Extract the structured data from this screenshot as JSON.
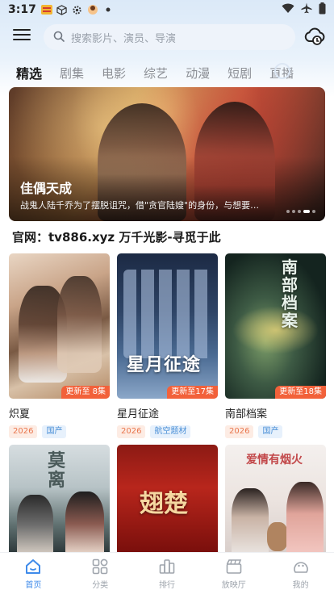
{
  "status_bar": {
    "time": "3:17"
  },
  "header": {
    "search_placeholder": "搜索影片、演员、导演"
  },
  "tabs": [
    {
      "label": "精选",
      "active": true
    },
    {
      "label": "剧集",
      "active": false
    },
    {
      "label": "电影",
      "active": false
    },
    {
      "label": "综艺",
      "active": false
    },
    {
      "label": "动漫",
      "active": false
    },
    {
      "label": "短剧",
      "active": false
    },
    {
      "label": "直播",
      "active": false
    }
  ],
  "banner": {
    "title": "佳偶天成",
    "description": "战鬼人陆千乔为了摆脱诅咒，借\"贪官陆嫂\"的身份，与想要…"
  },
  "section": {
    "title": "官网：tv886.xyz 万千光影-寻觅于此"
  },
  "cards": [
    {
      "title": "炽夏",
      "badge": "更新至 8集",
      "year": "2026",
      "category": "国产"
    },
    {
      "title": "星月征途",
      "badge": "更新至17集",
      "year": "2026",
      "category": "航空题材",
      "poster_text": "星月征途"
    },
    {
      "title": "南部档案",
      "badge": "更新至18集",
      "year": "2026",
      "category": "国产",
      "poster_text": "南部档案"
    },
    {
      "title": "",
      "poster_text": "莫离"
    },
    {
      "title": "",
      "poster_text": "翅楚"
    },
    {
      "title": "",
      "poster_text": "爱情有烟火"
    }
  ],
  "bottom_nav": [
    {
      "label": "首页",
      "icon": "home-icon",
      "active": true
    },
    {
      "label": "分类",
      "icon": "grid-icon",
      "active": false
    },
    {
      "label": "排行",
      "icon": "rank-icon",
      "active": false
    },
    {
      "label": "放映厅",
      "icon": "clapper-icon",
      "active": false
    },
    {
      "label": "我的",
      "icon": "user-icon",
      "active": false
    }
  ],
  "colors": {
    "accent": "#3f8bea",
    "badge": "#f2613a"
  }
}
